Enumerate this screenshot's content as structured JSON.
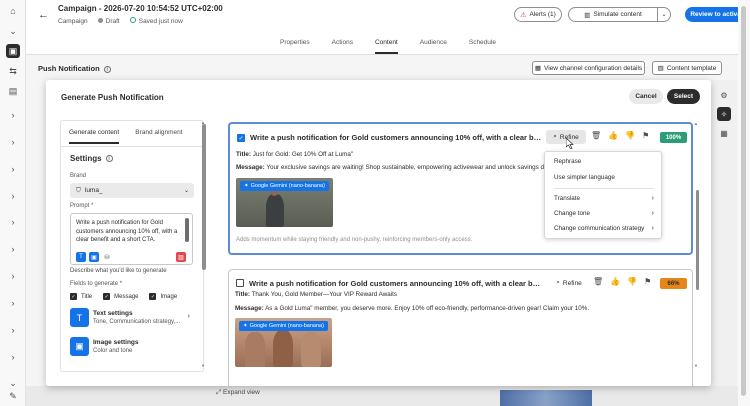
{
  "header": {
    "title": "Campaign - 2026-07-20 10:54:52 UTC+02:00",
    "breadcrumb": "Campaign",
    "status": "Draft",
    "saved": "Saved just now",
    "alerts_label": "Alerts (1)",
    "simulate_label": "Simulate content",
    "review_label": "Review to activate"
  },
  "tabs": [
    "Properties",
    "Actions",
    "Content",
    "Audience",
    "Schedule"
  ],
  "push": {
    "title": "Push Notification",
    "channel_btn": "View channel configuration details",
    "template_btn": "Content template"
  },
  "bottom": {
    "expand_label": "Expand view"
  },
  "modal": {
    "title": "Generate Push Notification",
    "cancel": "Cancel",
    "select": "Select",
    "left": {
      "tab_generate": "Generate content",
      "tab_brand": "Brand alignment",
      "settings_label": "Settings",
      "brand_label": "Brand",
      "brand_value": "luma_",
      "prompt_label": "Prompt *",
      "prompt_text": "Write a push notification for Gold customers announcing 10% off, with a clear benefit and a short CTA.",
      "describe_label": "Describe what you'd like to generate",
      "fields_label": "Fields to generate *",
      "fields": [
        "Title",
        "Message",
        "Image"
      ],
      "text_settings_name": "Text settings",
      "text_settings_desc": "Tone, Communication strategy,...",
      "image_settings_name": "Image settings",
      "image_settings_desc": "Color and tone"
    },
    "cards": [
      {
        "heading": "Write a push notification for Gold customers announcing 10% off, with a clear benefit a...",
        "refine": "Refine",
        "score": "100%",
        "score_color": "#2d9d78",
        "title_label": "Title:",
        "title_value": "Just for Gold: Get 10% Off at Luma\"",
        "message_label": "Message:",
        "message_value": "Your exclusive savings are waiting! Shop sustainable, empowering activewear and unlock savings designed",
        "image_badge": "Google Gemini (nano-banana)",
        "note": "Adds momentum while staying friendly and non-pushy, reinforcing members-only access."
      },
      {
        "heading": "Write a push notification for Gold customers announcing 10% off, with a clear benefit an...",
        "refine": "Refine",
        "score": "66%",
        "score_color": "#e68619",
        "title_label": "Title:",
        "title_value": "Thank You, Gold Member—Your VIP Reward Awaits",
        "message_label": "Message:",
        "message_value": "As a Gold Luma\" member, you deserve more. Enjoy 10% off eco-friendly, performance-driven gear! Claim your 10%.",
        "image_badge": "Google Gemini (nano-banana)"
      }
    ],
    "refine_menu": {
      "rephrase": "Rephrase",
      "simpler": "Use simpler language",
      "translate": "Translate",
      "change_tone": "Change tone",
      "change_strategy": "Change communication strategy"
    }
  }
}
